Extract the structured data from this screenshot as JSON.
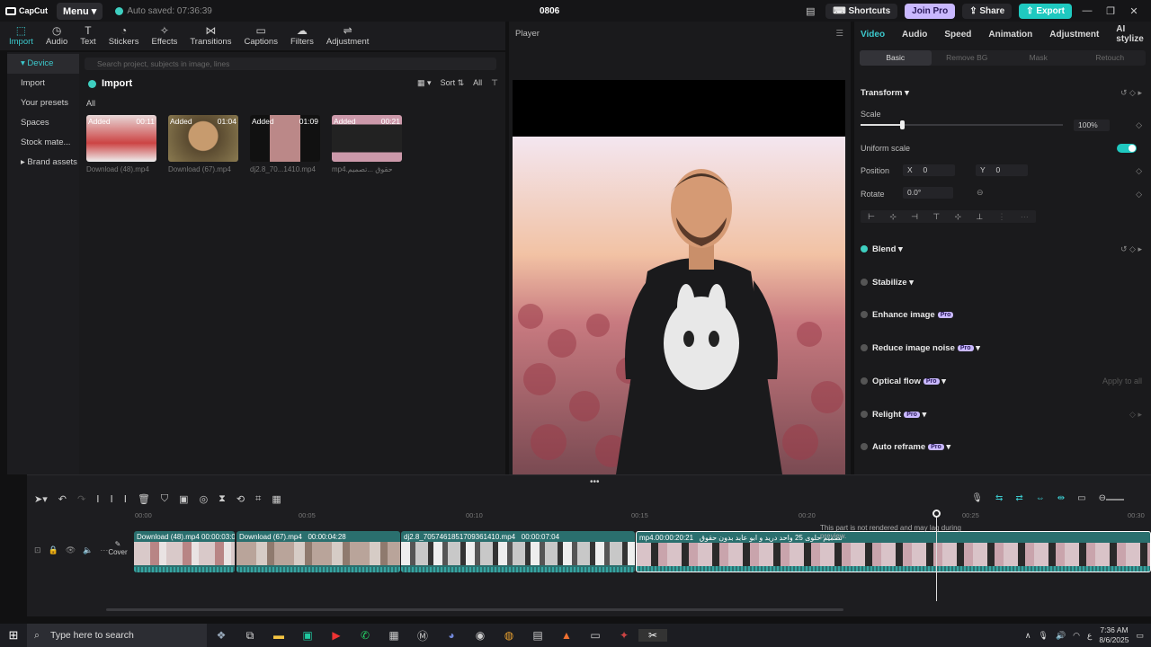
{
  "titlebar": {
    "app_name": "CapCut",
    "menu_label": "Menu",
    "autosave": "Auto saved: 07:36:39",
    "project_title": "0806",
    "shortcuts": "Shortcuts",
    "join_pro": "Join Pro",
    "share": "Share",
    "export": "Export"
  },
  "toolbar": {
    "tools": [
      {
        "label": "Import",
        "icon": "import-icon"
      },
      {
        "label": "Audio",
        "icon": "audio-icon"
      },
      {
        "label": "Text",
        "icon": "text-icon"
      },
      {
        "label": "Stickers",
        "icon": "stickers-icon"
      },
      {
        "label": "Effects",
        "icon": "effects-icon"
      },
      {
        "label": "Transitions",
        "icon": "transitions-icon"
      },
      {
        "label": "Captions",
        "icon": "captions-icon"
      },
      {
        "label": "Filters",
        "icon": "filters-icon"
      },
      {
        "label": "Adjustment",
        "icon": "adjustment-icon"
      }
    ]
  },
  "leftnav": {
    "items": [
      "Device",
      "Import",
      "Your presets",
      "Spaces",
      "Stock mate...",
      "Brand assets"
    ]
  },
  "media": {
    "search_placeholder": "Search project, subjects in image, lines",
    "import_label": "Import",
    "sort": "Sort",
    "all": "All",
    "section_all": "All",
    "items": [
      {
        "tag": "Added",
        "duration": "00:11",
        "name": "Download (48).mp4"
      },
      {
        "tag": "Added",
        "duration": "01:04",
        "name": "Download (67).mp4"
      },
      {
        "tag": "Added",
        "duration": "01:09",
        "name": "dj2.8_70...1410.mp4"
      },
      {
        "tag": "Added",
        "duration": "00:21",
        "name": "mp4.حقوق ...تصميم"
      }
    ]
  },
  "player": {
    "title": "Player"
  },
  "props": {
    "tabs": [
      "Video",
      "Audio",
      "Speed",
      "Animation",
      "Adjustment",
      "AI stylize"
    ],
    "subtabs": [
      "Basic",
      "Remove BG",
      "Mask",
      "Retouch"
    ],
    "transform": "Transform",
    "scale_label": "Scale",
    "scale_value": "100%",
    "uniform_scale": "Uniform scale",
    "position_label": "Position",
    "pos_x_label": "X",
    "pos_x": "0",
    "pos_y_label": "Y",
    "pos_y": "0",
    "rotate_label": "Rotate",
    "rotate_value": "0.0°",
    "blend": "Blend",
    "stabilize": "Stabilize",
    "enhance": "Enhance image",
    "noise": "Reduce image noise",
    "optical": "Optical flow",
    "apply_all": "Apply to all",
    "relight": "Relight",
    "reframe": "Auto reframe",
    "pro": "Pro"
  },
  "timeline": {
    "ruler": [
      "00:00",
      "00:05",
      "00:10",
      "00:15",
      "00:20",
      "00:25",
      "00:30"
    ],
    "cover": "Cover",
    "clips": [
      {
        "name": "Download (48).mp4",
        "duration": "00:00:03:0"
      },
      {
        "name": "Download (67).mp4",
        "duration": "00:00:04:28"
      },
      {
        "name": "dj2.8_7057461851709361410.mp4",
        "duration": "00:00:07:04"
      },
      {
        "name": "mp4.تصميم حلوى 25 واحد دريد و ابو عابد بدون حقوق",
        "duration": "00:00:20:21"
      }
    ],
    "tooltip": "This part is not rendered and may lag during preview."
  },
  "taskbar": {
    "search": "Type here to search",
    "time": "7:36 AM",
    "date": "8/6/2025"
  },
  "colors": {
    "accent": "#3cc8cc",
    "pro": "#c9b8ff",
    "export": "#1fc9c0"
  }
}
